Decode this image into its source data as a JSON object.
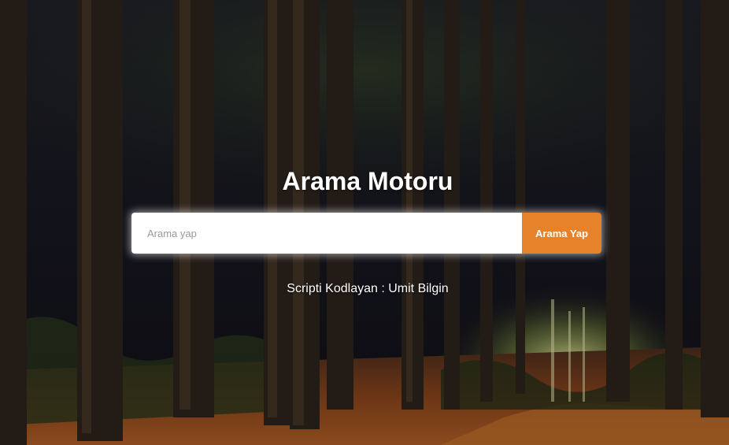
{
  "header": {
    "title": "Arama Motoru"
  },
  "search": {
    "placeholder": "Arama yap",
    "value": "",
    "button_label": "Arama Yap"
  },
  "footer": {
    "credit": "Scripti Kodlayan : Umit Bilgin"
  },
  "colors": {
    "accent": "#e5822a",
    "title_text": "#ffffff",
    "background_dark": "#14121c",
    "forest_floor": "#6b3516"
  },
  "background": {
    "image_semantic": "dark-forest-path-photo"
  }
}
